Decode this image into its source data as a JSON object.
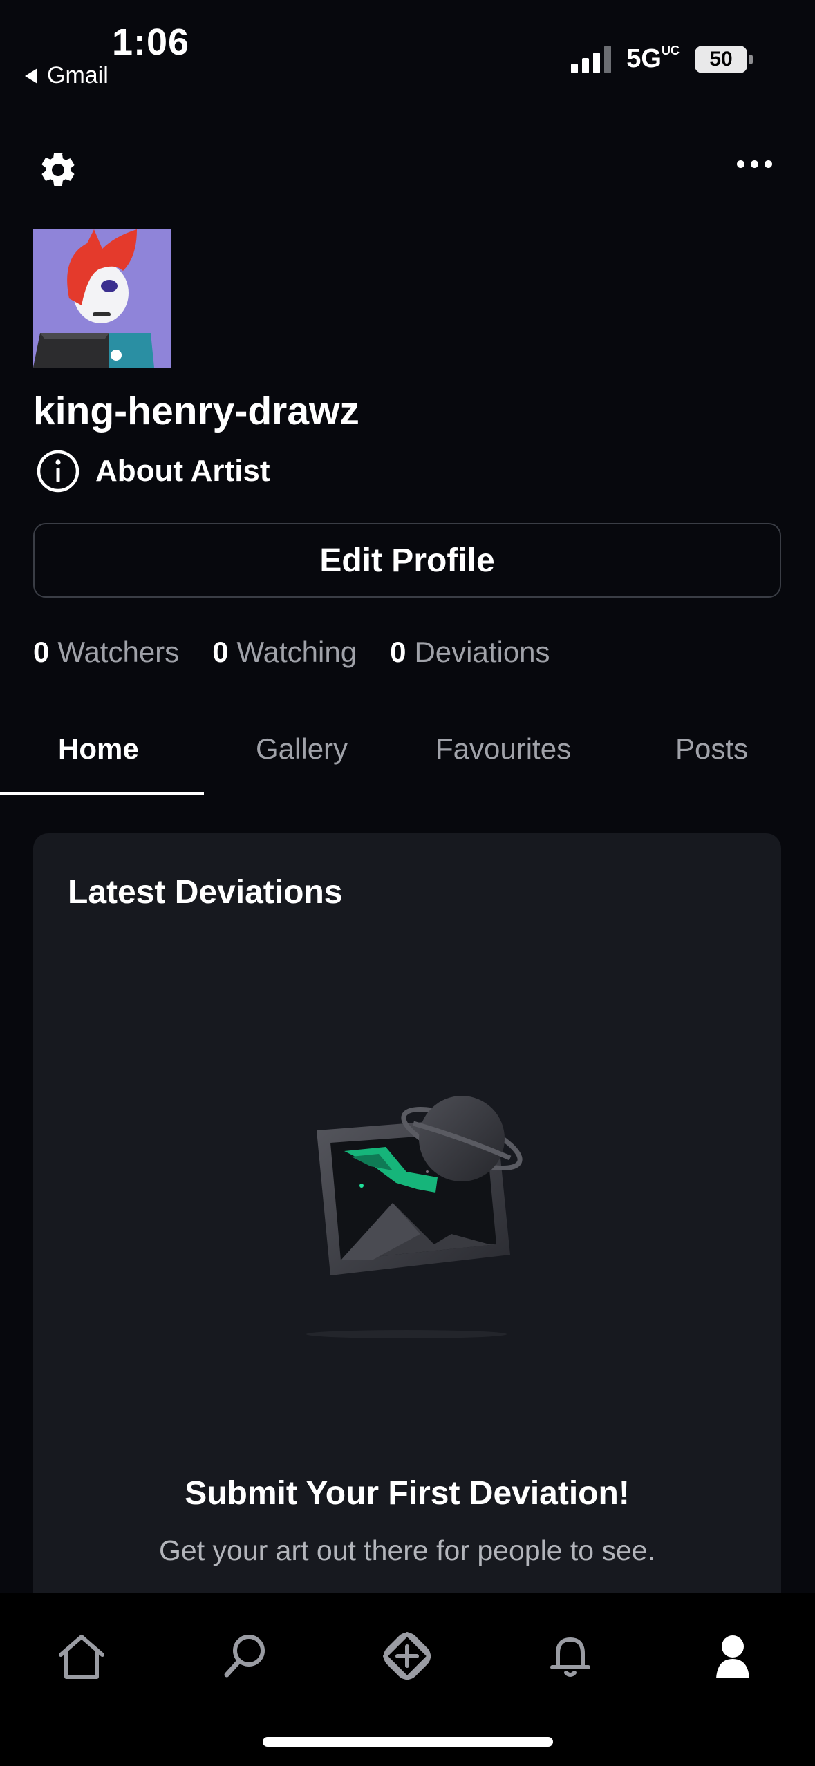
{
  "status_bar": {
    "time": "1:06",
    "back_app": "Gmail",
    "network": "5G",
    "network_suffix": "UC",
    "battery": "50"
  },
  "header": {
    "settings_icon": "gear-icon",
    "more_icon": "more-horizontal-icon"
  },
  "profile": {
    "username": "king-henry-drawz",
    "about_label": "About Artist",
    "edit_button": "Edit Profile"
  },
  "stats": [
    {
      "count": "0",
      "label": "Watchers"
    },
    {
      "count": "0",
      "label": "Watching"
    },
    {
      "count": "0",
      "label": "Deviations"
    }
  ],
  "tabs": [
    {
      "label": "Home",
      "active": true
    },
    {
      "label": "Gallery",
      "active": false
    },
    {
      "label": "Favourites",
      "active": false
    },
    {
      "label": "Posts",
      "active": false
    }
  ],
  "latest": {
    "title": "Latest Deviations",
    "empty_title": "Submit Your First Deviation!",
    "empty_subtitle": "Get your art out there for people to see."
  },
  "bottom_nav": [
    {
      "icon": "home-icon",
      "active": false
    },
    {
      "icon": "search-icon",
      "active": false
    },
    {
      "icon": "submit-plus-icon",
      "active": false
    },
    {
      "icon": "bell-icon",
      "active": false
    },
    {
      "icon": "profile-icon",
      "active": true
    }
  ],
  "colors": {
    "background": "#07080d",
    "card": "#17191f",
    "muted_text": "#a0a2a9",
    "accent_green": "#1fd48a"
  }
}
